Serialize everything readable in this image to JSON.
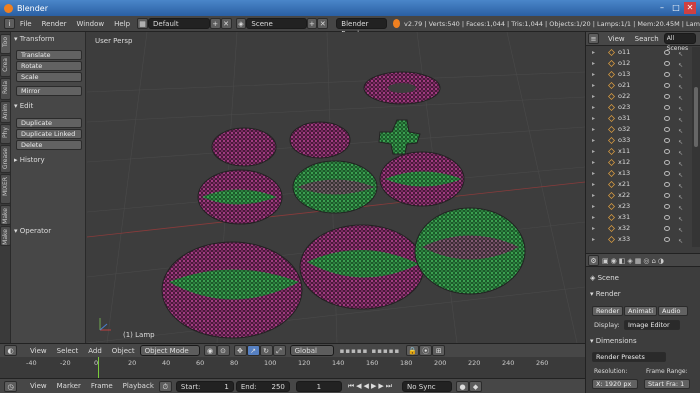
{
  "window": {
    "title": "Blender"
  },
  "topbar": {
    "menus": [
      "File",
      "Render",
      "Window",
      "Help"
    ],
    "layout": "Default",
    "scene": "Scene",
    "engine": "Blender Render",
    "stats": "v2.79 | Verts:540 | Faces:1,044 | Tris:1,044 | Objects:1/20 | Lamps:1/1 | Mem:20.45M | Lam"
  },
  "toolshelf": {
    "tabs": [
      "Too",
      "Crea",
      "Rela",
      "Anim",
      "Phy",
      "Grease",
      "MIXER",
      "Make",
      "Make"
    ],
    "transform_header": "Transform",
    "transform_buttons": [
      "Translate",
      "Rotate",
      "Scale"
    ],
    "mirror": "Mirror",
    "edit_header": "Edit",
    "edit_buttons": [
      "Duplicate",
      "Duplicate Linked",
      "Delete"
    ],
    "history_header": "History",
    "operator_header": "Operator"
  },
  "viewport": {
    "label": "User Persp",
    "object_label": "(1) Lamp"
  },
  "outliner": {
    "view": "View",
    "search": "Search",
    "scenes": "All Scenes",
    "items": [
      "o11",
      "o12",
      "o13",
      "o21",
      "o22",
      "o23",
      "o31",
      "o32",
      "o33",
      "x11",
      "x12",
      "x13",
      "x21",
      "x22",
      "x23",
      "x31",
      "x32",
      "x33"
    ]
  },
  "properties": {
    "scene_label": "Scene",
    "render_header": "Render",
    "render_btn": "Render",
    "anim_btn": "Animati",
    "audio_btn": "Audio",
    "display_label": "Display:",
    "display_value": "Image Editor",
    "dimensions_header": "Dimensions",
    "presets": "Render Presets",
    "resolution_label": "Resolution:",
    "frame_range_label": "Frame Range:",
    "res_x": "X: 1920 px",
    "start_fra": "Start Fra: 1"
  },
  "view3d_header": {
    "menus": [
      "View",
      "Select",
      "Add",
      "Object"
    ],
    "mode": "Object Mode",
    "orientation": "Global"
  },
  "timeline": {
    "ticks": [
      "-40",
      "-20",
      "0",
      "20",
      "40",
      "60",
      "80",
      "100",
      "120",
      "140",
      "160",
      "180",
      "200",
      "220",
      "240",
      "260"
    ]
  },
  "timeline_header": {
    "menus": [
      "View",
      "Marker",
      "Frame",
      "Playback"
    ],
    "start_label": "Start:",
    "start": "1",
    "end_label": "End:",
    "end": "250",
    "current": "1",
    "sync": "No Sync"
  }
}
